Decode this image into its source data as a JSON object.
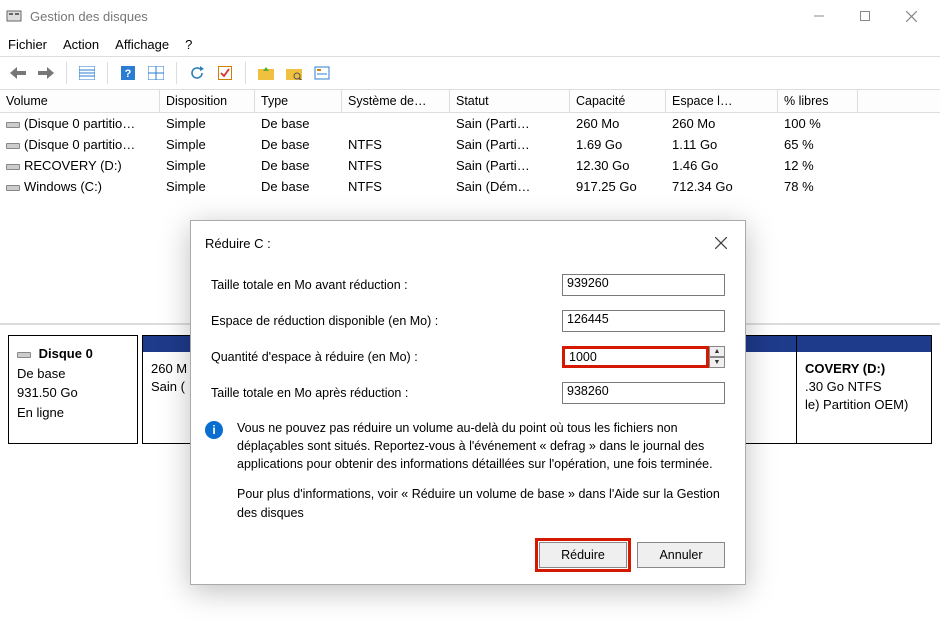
{
  "window": {
    "title": "Gestion des disques"
  },
  "menu": {
    "file": "Fichier",
    "action": "Action",
    "view": "Affichage",
    "help": "?"
  },
  "table": {
    "headers": {
      "volume": "Volume",
      "layout": "Disposition",
      "type": "Type",
      "fs": "Système de…",
      "status": "Statut",
      "capacity": "Capacité",
      "free": "Espace l…",
      "pct": "% libres"
    },
    "rows": [
      {
        "volume": "(Disque 0 partitio…",
        "layout": "Simple",
        "type": "De base",
        "fs": "",
        "status": "Sain (Parti…",
        "capacity": "260 Mo",
        "free": "260 Mo",
        "pct": "100 %"
      },
      {
        "volume": "(Disque 0 partitio…",
        "layout": "Simple",
        "type": "De base",
        "fs": "NTFS",
        "status": "Sain (Parti…",
        "capacity": "1.69 Go",
        "free": "1.11 Go",
        "pct": "65 %"
      },
      {
        "volume": "RECOVERY (D:)",
        "layout": "Simple",
        "type": "De base",
        "fs": "NTFS",
        "status": "Sain (Parti…",
        "capacity": "12.30 Go",
        "free": "1.46 Go",
        "pct": "12 %"
      },
      {
        "volume": "Windows (C:)",
        "layout": "Simple",
        "type": "De base",
        "fs": "NTFS",
        "status": "Sain (Dém…",
        "capacity": "917.25 Go",
        "free": "712.34 Go",
        "pct": "78 %"
      }
    ]
  },
  "disk": {
    "name": "Disque 0",
    "type": "De base",
    "size": "931.50 Go",
    "status": "En ligne",
    "seg0": {
      "l1": "260 M",
      "l2": "Sain ("
    },
    "seg1": {
      "l1": "COVERY  (D:)",
      "l2": ".30 Go NTFS",
      "l3": "le) Partition OEM)"
    }
  },
  "dialog": {
    "title": "Réduire C :",
    "labels": {
      "total_before": "Taille totale en Mo avant réduction :",
      "available": "Espace de réduction disponible (en Mo) :",
      "amount": "Quantité d'espace à réduire (en Mo) :",
      "total_after": "Taille totale en Mo après réduction :"
    },
    "values": {
      "total_before": "939260",
      "available": "126445",
      "amount": "1000",
      "total_after": "938260"
    },
    "info1": "Vous ne pouvez pas réduire un volume au-delà du point où tous les fichiers non déplaçables sont situés. Reportez-vous à l'événement « defrag » dans le journal des applications pour obtenir des informations détaillées sur l'opération, une fois terminée.",
    "info2": "Pour plus d'informations, voir « Réduire un volume de base » dans l'Aide sur la Gestion des disques",
    "buttons": {
      "shrink": "Réduire",
      "cancel": "Annuler"
    }
  }
}
